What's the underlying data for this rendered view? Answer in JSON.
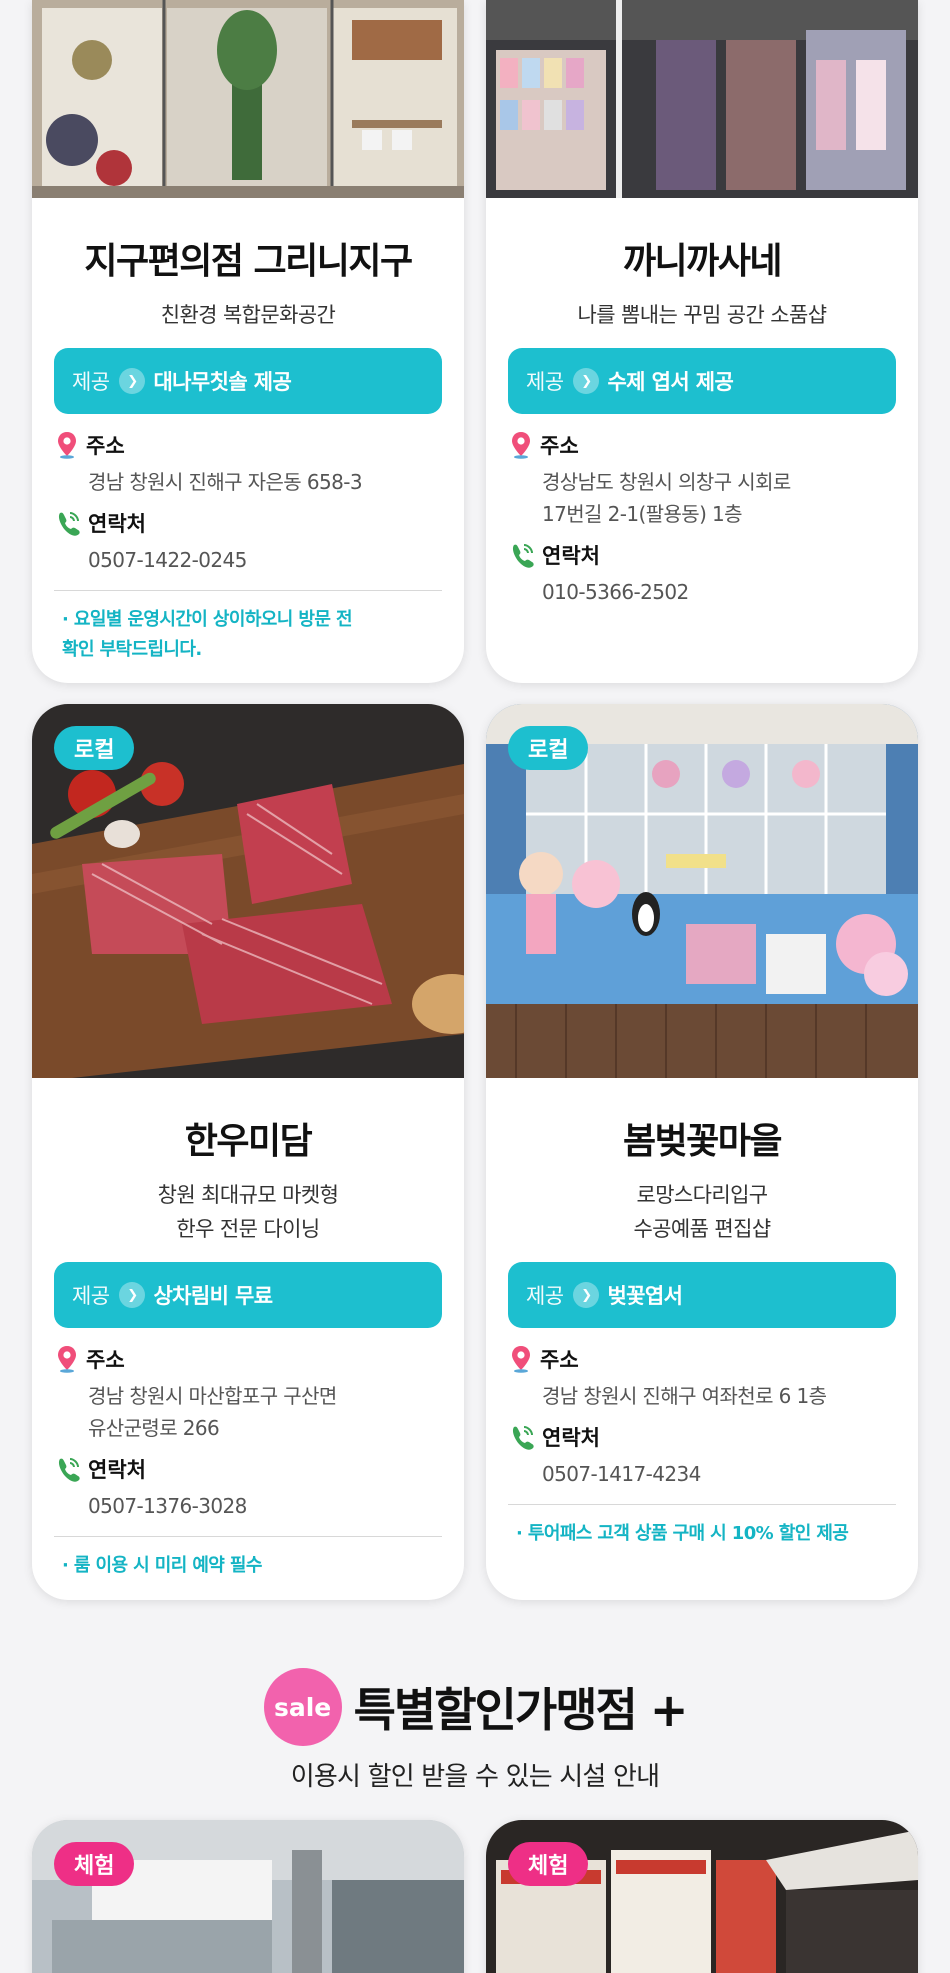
{
  "labels": {
    "offer_label": "제공",
    "address_label": "주소",
    "contact_label": "연락처"
  },
  "colors": {
    "accent_teal": "#1dbfcf",
    "accent_pink": "#ee2f86",
    "sale_pink": "#f262ad"
  },
  "stores": [
    {
      "name": "지구편의점 그리니지구",
      "desc": [
        "친환경 복합문화공간"
      ],
      "offer": "대나무칫솔 제공",
      "address": [
        "경남 창원시 진해구 자은동 658-3"
      ],
      "contact": "0507-1422-0245",
      "notice": [
        "· 요일별 운영시간이 상이하오니 방문 전",
        "확인 부탁드립니다."
      ]
    },
    {
      "name": "까니까사네",
      "desc": [
        "나를 뽐내는 꾸밈 공간 소품샵"
      ],
      "offer": "수제 엽서 제공",
      "address": [
        "경상남도 창원시 의창구 시회로",
        "17번길 2-1(팔용동) 1층"
      ],
      "contact": "010-5366-2502"
    },
    {
      "tag": "로컬",
      "name": "한우미담",
      "desc": [
        "창원 최대규모 마켓형",
        "한우 전문 다이닝"
      ],
      "offer": "상차림비 무료",
      "address": [
        "경남 창원시 마산합포구 구산면",
        "유산군령로 266"
      ],
      "contact": "0507-1376-3028",
      "notice": [
        "· 룸 이용 시 미리 예약 필수"
      ]
    },
    {
      "tag": "로컬",
      "name": "봄벚꽃마을",
      "desc": [
        "로망스다리입구",
        "수공예품 편집샵"
      ],
      "offer": "벚꽃엽서",
      "address": [
        "경남 창원시 진해구 여좌천로 6 1층"
      ],
      "contact": "0507-1417-4234",
      "notice": [
        "· 투어패스 고객 상품 구매 시 10% 할인 제공"
      ]
    }
  ],
  "section": {
    "badge": "sale",
    "title": "특별할인가맹점 +",
    "subtitle": "이용시 할인 받을 수 있는 시설 안내"
  },
  "bottom_cards": [
    {
      "tag": "체험"
    },
    {
      "tag": "체험"
    }
  ]
}
